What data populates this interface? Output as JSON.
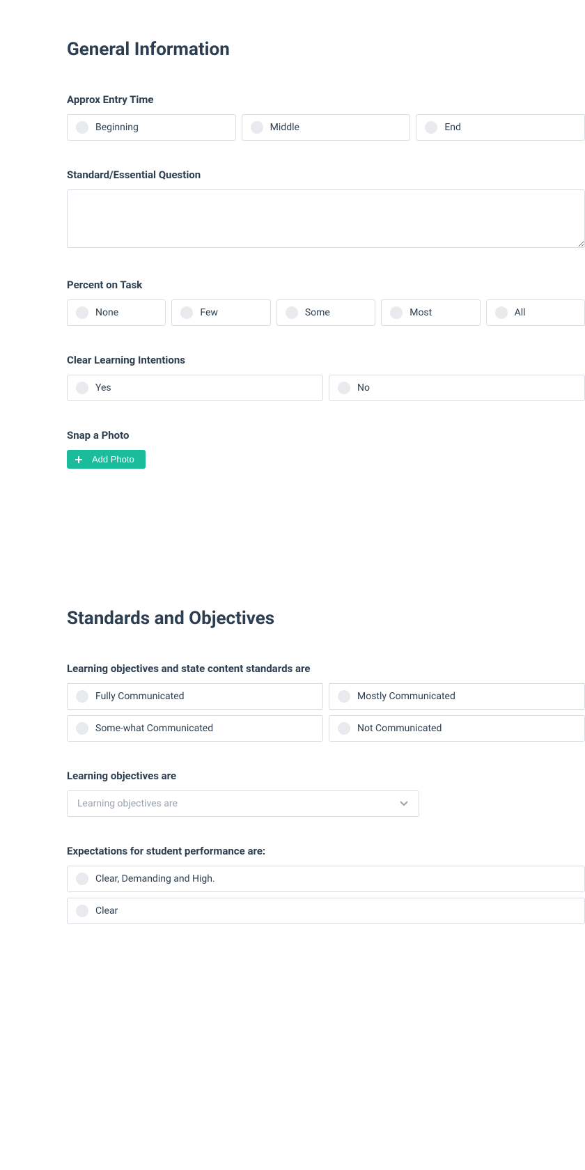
{
  "sections": {
    "general": {
      "title": "General Information",
      "entry_time": {
        "label": "Approx Entry Time",
        "options": [
          "Beginning",
          "Middle",
          "End"
        ]
      },
      "standard_question": {
        "label": "Standard/Essential Question"
      },
      "percent_on_task": {
        "label": "Percent on Task",
        "options": [
          "None",
          "Few",
          "Some",
          "Most",
          "All"
        ]
      },
      "clear_intentions": {
        "label": "Clear Learning Intentions",
        "options": [
          "Yes",
          "No"
        ]
      },
      "snap_photo": {
        "label": "Snap a Photo",
        "button": "Add Photo"
      }
    },
    "standards": {
      "title": "Standards and Objectives",
      "objectives_communicated": {
        "label": "Learning objectives and state content standards are",
        "options": [
          "Fully Communicated",
          "Mostly Communicated",
          "Some-what Communicated",
          "Not Communicated"
        ]
      },
      "learning_objectives": {
        "label": "Learning objectives are",
        "placeholder": "Learning objectives are"
      },
      "expectations": {
        "label": "Expectations for student performance are:",
        "options": [
          "Clear, Demanding and High.",
          "Clear"
        ]
      }
    }
  }
}
